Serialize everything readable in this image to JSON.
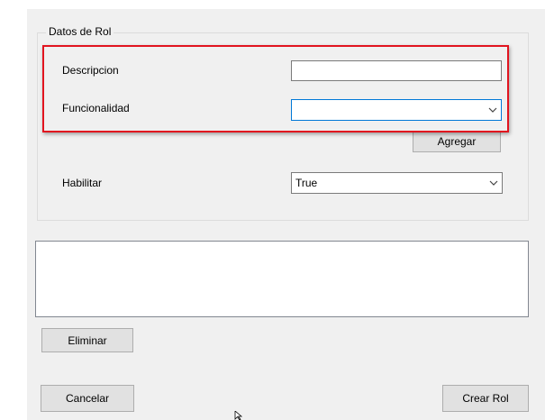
{
  "group": {
    "title": "Datos de Rol"
  },
  "descripcion": {
    "label": "Descripcion",
    "value": ""
  },
  "funcionalidad": {
    "label": "Funcionalidad",
    "selected": ""
  },
  "agregar_label": "Agregar",
  "habilitar": {
    "label": "Habilitar",
    "selected": "True"
  },
  "list_items": [],
  "eliminar_label": "Eliminar",
  "cancelar_label": "Cancelar",
  "crear_label": "Crear Rol",
  "colors": {
    "form_background": "#f0f0f0",
    "highlight_border": "#e1141f",
    "focus_border": "#0078d7"
  },
  "icons": {
    "combo_arrow": "chevron-down-icon",
    "pointer": "mouse-cursor-icon"
  }
}
